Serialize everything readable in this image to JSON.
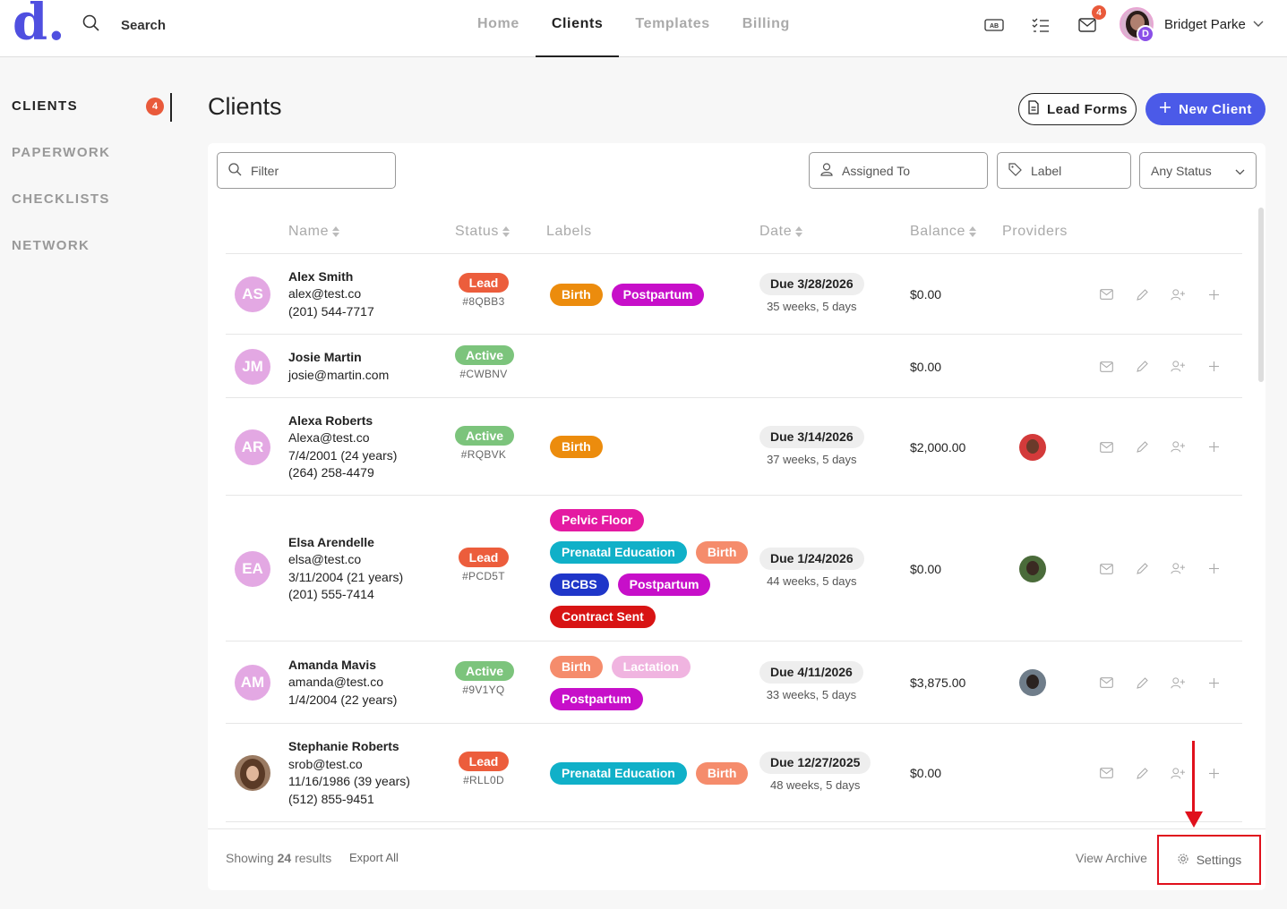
{
  "brand": {
    "logo": "d",
    "accent": "#4f4fe0"
  },
  "topbar": {
    "search_label": "Search",
    "nav": [
      {
        "label": "Home",
        "active": false
      },
      {
        "label": "Clients",
        "active": true
      },
      {
        "label": "Templates",
        "active": false
      },
      {
        "label": "Billing",
        "active": false
      }
    ],
    "icons": [
      "ab-test-icon",
      "checklist-icon",
      "mail-icon"
    ],
    "mail_count": "4",
    "user": {
      "name": "Bridget Parke",
      "badge": "D"
    }
  },
  "sidebar": {
    "items": [
      {
        "label": "CLIENTS",
        "count": "4",
        "active": true
      },
      {
        "label": "PAPERWORK"
      },
      {
        "label": "CHECKLISTS"
      },
      {
        "label": "NETWORK"
      }
    ]
  },
  "header": {
    "title": "Clients",
    "lead_forms": "Lead Forms",
    "new_client": "New Client"
  },
  "filters": {
    "filter_placeholder": "Filter",
    "assigned_to": "Assigned To",
    "label": "Label",
    "status": "Any Status"
  },
  "table": {
    "columns": [
      "Name",
      "Status",
      "Labels",
      "Date",
      "Balance",
      "Providers"
    ],
    "rows": [
      {
        "initials": "AS",
        "name": "Alex Smith",
        "details": [
          "alex@test.co",
          "(201) 544-7717"
        ],
        "status": "Lead",
        "code": "#8QBB3",
        "labels": [
          [
            {
              "text": "Birth",
              "color": "#ec8c0d"
            },
            {
              "text": "Postpartum",
              "color": "#c70fc9"
            }
          ]
        ],
        "due": "Due 3/28/2026",
        "weeks": "35 weeks, 5 days",
        "balance": "$0.00",
        "provider": null
      },
      {
        "initials": "JM",
        "name": "Josie Martin",
        "details": [
          "josie@martin.com"
        ],
        "status": "Active",
        "code": "#CWBNV",
        "labels": [],
        "due": "",
        "weeks": "",
        "balance": "$0.00",
        "provider": null
      },
      {
        "initials": "AR",
        "name": "Alexa Roberts",
        "details": [
          "Alexa@test.co",
          "7/4/2001 (24 years)",
          "(264) 258-4479"
        ],
        "status": "Active",
        "code": "#RQBVK",
        "labels": [
          [
            {
              "text": "Birth",
              "color": "#ec8c0d"
            }
          ]
        ],
        "due": "Due 3/14/2026",
        "weeks": "37 weeks, 5 days",
        "balance": "$2,000.00",
        "provider": "red"
      },
      {
        "initials": "EA",
        "name": "Elsa Arendelle",
        "details": [
          "elsa@test.co",
          "3/11/2004 (21 years)",
          "(201) 555-7414"
        ],
        "status": "Lead",
        "code": "#PCD5T",
        "labels": [
          [
            {
              "text": "Pelvic Floor",
              "color": "#e41aa2"
            }
          ],
          [
            {
              "text": "Prenatal Education",
              "color": "#10b0c8"
            },
            {
              "text": "Birth",
              "color": "#f58c6c"
            }
          ],
          [
            {
              "text": "BCBS",
              "color": "#1f36c9"
            },
            {
              "text": "Postpartum",
              "color": "#c70fc9"
            }
          ],
          [
            {
              "text": "Contract Sent",
              "color": "#d81414"
            }
          ]
        ],
        "due": "Due 1/24/2026",
        "weeks": "44 weeks, 5 days",
        "balance": "$0.00",
        "provider": "green"
      },
      {
        "initials": "AM",
        "name": "Amanda Mavis",
        "details": [
          "amanda@test.co",
          "1/4/2004 (22 years)"
        ],
        "status": "Active",
        "code": "#9V1YQ",
        "labels": [
          [
            {
              "text": "Birth",
              "color": "#f58c6c"
            },
            {
              "text": "Lactation",
              "color": "#f0b4e0"
            }
          ],
          [
            {
              "text": "Postpartum",
              "color": "#c70fc9"
            }
          ]
        ],
        "due": "Due 4/11/2026",
        "weeks": "33 weeks, 5 days",
        "balance": "$3,875.00",
        "provider": "gray"
      },
      {
        "initials": "",
        "name": "Stephanie Roberts",
        "details": [
          "srob@test.co",
          "11/16/1986 (39 years)",
          "(512) 855-9451"
        ],
        "status": "Lead",
        "code": "#RLL0D",
        "labels": [
          [
            {
              "text": "Prenatal Education",
              "color": "#10b0c8"
            },
            {
              "text": "Birth",
              "color": "#f58c6c"
            }
          ]
        ],
        "due": "Due 12/27/2025",
        "weeks": "48 weeks, 5 days",
        "balance": "$0.00",
        "provider": null
      }
    ]
  },
  "footer": {
    "showing_prefix": "Showing",
    "showing_count": "24",
    "showing_suffix": "results",
    "export": "Export All",
    "archive": "View Archive",
    "settings": "Settings"
  }
}
